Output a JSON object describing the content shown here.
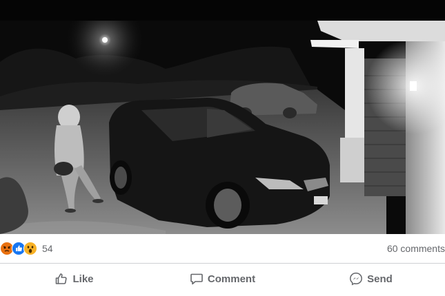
{
  "post": {
    "image_alt": "Night-time security camera footage: hooded person near parked hatchback in driveway",
    "reactions": {
      "icons": [
        "angry-icon",
        "like-icon",
        "wow-icon"
      ],
      "colors": {
        "angry": "#e9710f",
        "like": "#1877f2",
        "wow": "#f7b125"
      },
      "count": "54"
    },
    "comments_count": "60 comments"
  },
  "actions": {
    "like_label": "Like",
    "comment_label": "Comment",
    "send_label": "Send"
  }
}
